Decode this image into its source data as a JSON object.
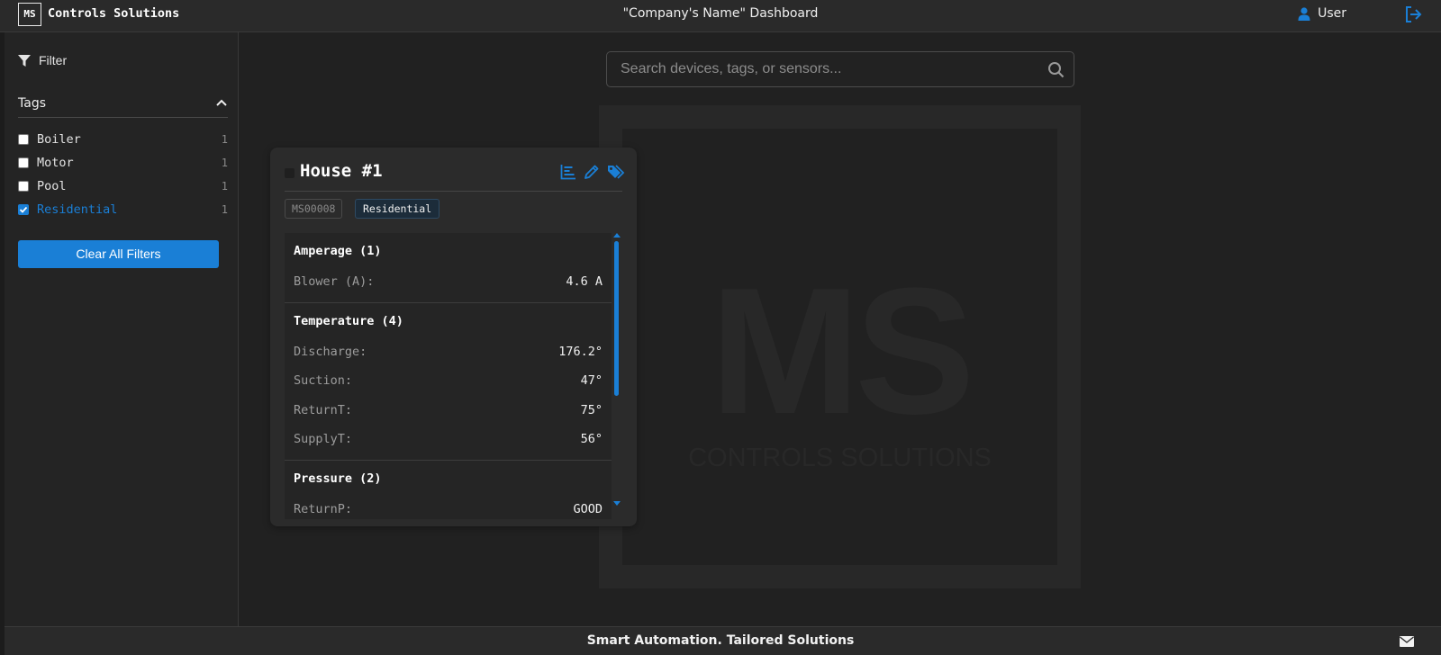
{
  "header": {
    "logo_text": "MS",
    "brand": "Controls Solutions",
    "title": "\"Company's Name\" Dashboard",
    "user_label": "User",
    "accent": "#1a7fd6"
  },
  "sidebar": {
    "filter_label": "Filter",
    "tags_heading": "Tags",
    "tags": [
      {
        "label": "Boiler",
        "count": "1",
        "checked": false
      },
      {
        "label": "Motor",
        "count": "1",
        "checked": false
      },
      {
        "label": "Pool",
        "count": "1",
        "checked": false
      },
      {
        "label": "Residential",
        "count": "1",
        "checked": true
      }
    ],
    "clear_label": "Clear All Filters"
  },
  "search": {
    "placeholder": "Search devices, tags, or sensors..."
  },
  "watermark": {
    "ms": "MS",
    "subtitle": "CONTROLS SOLUTIONS"
  },
  "card": {
    "title": "House #1",
    "device_id": "MS00008",
    "tag": "Residential",
    "groups": [
      {
        "title": "Amperage (1)",
        "rows": [
          {
            "label": "Blower (A):",
            "value": "4.6 A"
          }
        ]
      },
      {
        "title": "Temperature (4)",
        "rows": [
          {
            "label": "Discharge:",
            "value": "176.2°"
          },
          {
            "label": "Suction:",
            "value": "47°"
          },
          {
            "label": "ReturnT:",
            "value": "75°"
          },
          {
            "label": "SupplyT:",
            "value": "56°"
          }
        ]
      },
      {
        "title": "Pressure (2)",
        "rows": [
          {
            "label": "ReturnP:",
            "value": "GOOD"
          }
        ]
      }
    ]
  },
  "footer": {
    "tagline": "Smart Automation. Tailored Solutions"
  }
}
